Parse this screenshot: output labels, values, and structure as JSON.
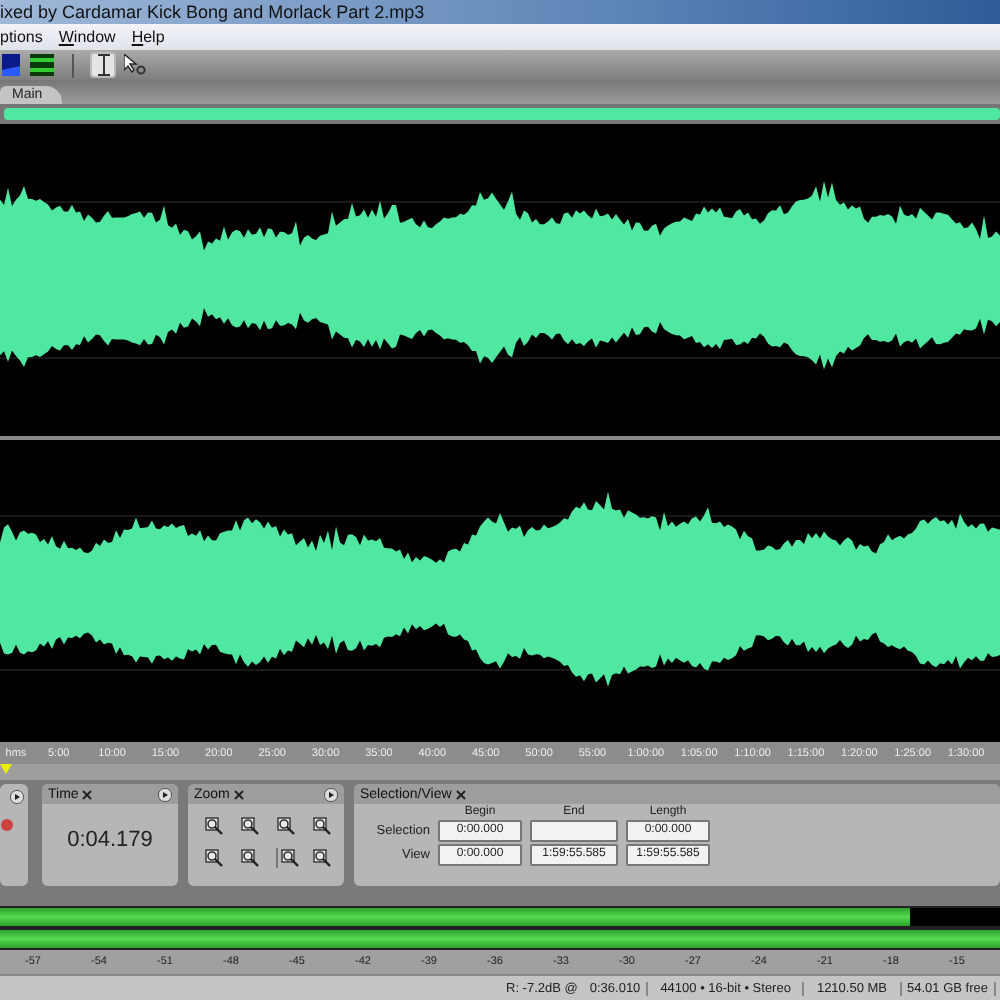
{
  "window": {
    "title": "ixed by Cardamar Kick Bong and Morlack Part 2.mp3"
  },
  "menu": [
    {
      "label": "ptions",
      "access_key": false
    },
    {
      "label": "Window",
      "access_key": true
    },
    {
      "label": "Help",
      "access_key": true
    }
  ],
  "toolbar": [
    {
      "kind": "spectral",
      "selected": false
    },
    {
      "kind": "waveform",
      "selected": false
    },
    {
      "kind": "time-selection",
      "selected": true
    },
    {
      "kind": "marquee",
      "selected": false
    }
  ],
  "tabs": [
    {
      "label": "Main",
      "selected": true
    }
  ],
  "time_ruler": {
    "labels": [
      "hms",
      "5:00",
      "10:00",
      "15:00",
      "20:00",
      "25:00",
      "30:00",
      "35:00",
      "40:00",
      "45:00",
      "50:00",
      "55:00",
      "1:00:00",
      "1:05:00",
      "1:10:00",
      "1:15:00",
      "1:20:00",
      "1:25:00",
      "1:30:00"
    ]
  },
  "time_panel": {
    "title": "Time",
    "value": "0:04.179"
  },
  "zoom_panel": {
    "title": "Zoom"
  },
  "selection_panel": {
    "title": "Selection/View",
    "columns": [
      "Begin",
      "End",
      "Length"
    ],
    "rows": [
      {
        "label": "Selection",
        "begin": "0:00.000",
        "length": "0:00.000"
      },
      {
        "label": "View",
        "begin": "0:00.000",
        "end": "1:59:55.585",
        "length": "1:59:55.585"
      }
    ]
  },
  "level_meter": {
    "channels": [
      {
        "level": 0.91
      },
      {
        "level": 1
      }
    ],
    "scale": [
      "-57",
      "-54",
      "-51",
      "-48",
      "-45",
      "-42",
      "-39",
      "-36",
      "-33",
      "-30",
      "-27",
      "-24",
      "-21",
      "-18",
      "-15"
    ]
  },
  "status_bar": [
    "R: -7.2dB @",
    "0:36.010",
    "44100 • 16-bit • Stereo",
    "1210.50 MB",
    "54.01 GB free"
  ]
}
